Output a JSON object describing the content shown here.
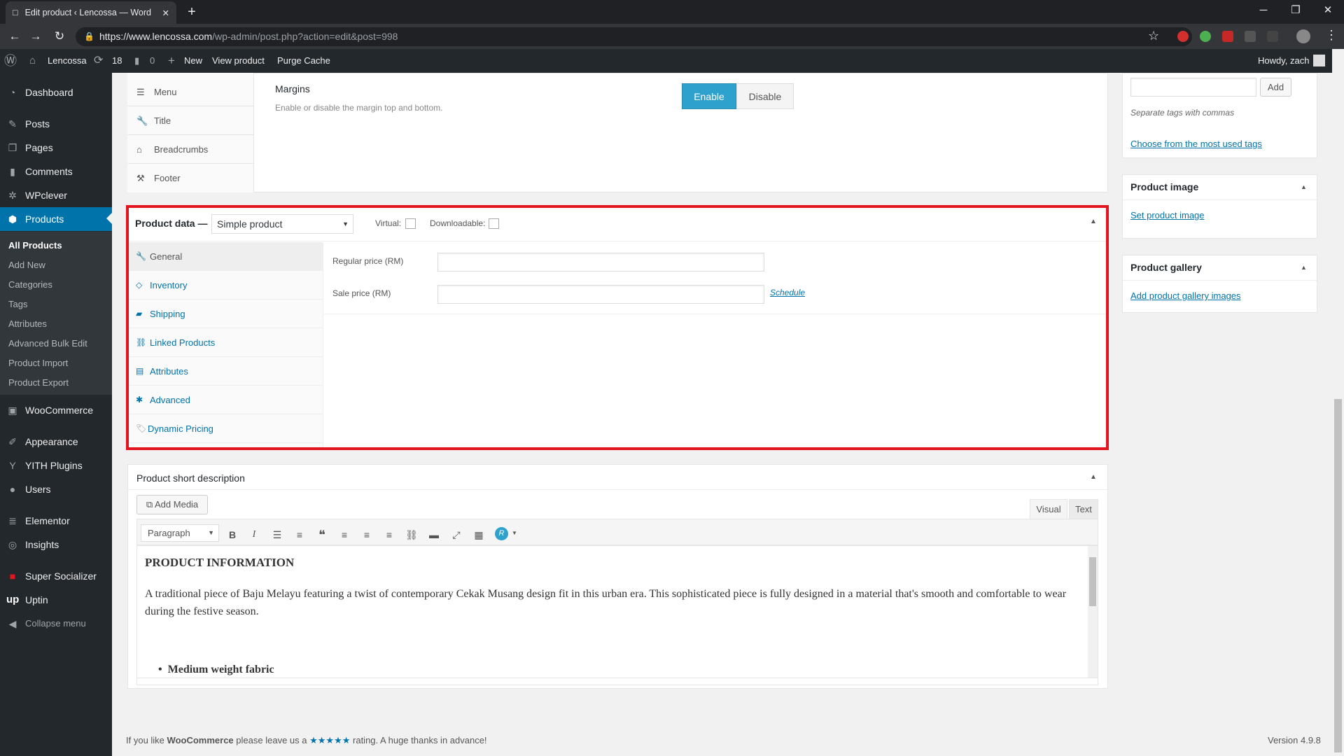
{
  "browser": {
    "tab_title": "Edit product ‹ Lencossa — Word",
    "url_host": "https://www.lencossa.com",
    "url_path": "/wp-admin/post.php?action=edit&post=998"
  },
  "adminbar": {
    "site": "Lencossa",
    "updates": "18",
    "comments": "0",
    "new": "New",
    "view_product": "View product",
    "purge": "Purge Cache",
    "howdy": "Howdy, zach"
  },
  "sidebar": {
    "items": [
      {
        "label": "Dashboard"
      },
      {
        "label": "Posts"
      },
      {
        "label": "Pages"
      },
      {
        "label": "Comments"
      },
      {
        "label": "WPclever"
      },
      {
        "label": "Products"
      },
      {
        "label": "WooCommerce"
      },
      {
        "label": "Appearance"
      },
      {
        "label": "YITH Plugins"
      },
      {
        "label": "Users"
      },
      {
        "label": "Elementor"
      },
      {
        "label": "Insights"
      },
      {
        "label": "Super Socializer"
      },
      {
        "label": "Uptin"
      },
      {
        "label": "Collapse menu"
      }
    ],
    "submenu": [
      "All Products",
      "Add New",
      "Categories",
      "Tags",
      "Attributes",
      "Advanced Bulk Edit",
      "Product Import",
      "Product Export"
    ]
  },
  "theme_options": {
    "tabs": [
      "Menu",
      "Title",
      "Breadcrumbs",
      "Footer"
    ],
    "margins_title": "Margins",
    "margins_desc": "Enable or disable the margin top and bottom.",
    "enable": "Enable",
    "disable": "Disable"
  },
  "product_data": {
    "title": "Product data —",
    "type_selected": "Simple product",
    "virtual": "Virtual:",
    "downloadable": "Downloadable:",
    "tabs": [
      "General",
      "Inventory",
      "Shipping",
      "Linked Products",
      "Attributes",
      "Advanced",
      "Dynamic Pricing"
    ],
    "regular_price": "Regular price (RM)",
    "sale_price": "Sale price (RM)",
    "schedule": "Schedule"
  },
  "short_desc": {
    "title": "Product short description",
    "add_media": "Add Media",
    "visual": "Visual",
    "text": "Text",
    "format": "Paragraph",
    "heading": "PRODUCT INFORMATION",
    "body": "A traditional piece of Baju Melayu featuring a twist of contemporary Cekak Musang design fit in this urban era. This sophisticated piece is fully designed in a material that's smooth and comfortable to wear during the festive season.",
    "bullet": "Medium weight fabric"
  },
  "tags_box": {
    "add": "Add",
    "hint": "Separate tags with commas",
    "link": "Choose from the most used tags"
  },
  "product_image": {
    "title": "Product image",
    "link": "Set product image"
  },
  "product_gallery": {
    "title": "Product gallery",
    "link": "Add product gallery images"
  },
  "footer": {
    "pre": "If you like",
    "brand": "WooCommerce",
    "mid": "please leave us a",
    "stars": "★★★★★",
    "post": "rating. A huge thanks in advance!",
    "version": "Version 4.9.8"
  },
  "colors": {
    "accent": "#0073aa",
    "highlight": "#e2141d",
    "enable_btn": "#2ea2cc"
  }
}
